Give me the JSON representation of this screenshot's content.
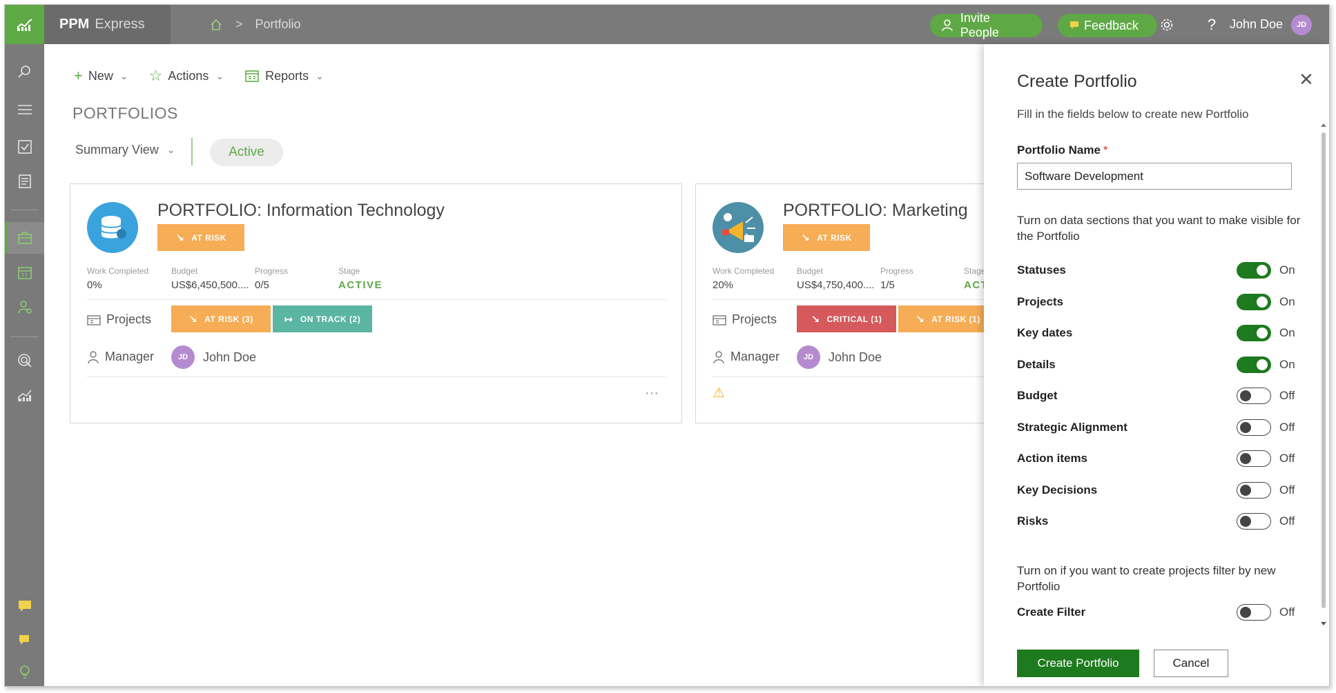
{
  "header": {
    "brand_main": "PPM",
    "brand_sub": "Express",
    "breadcrumb": "Portfolio",
    "invite_label": "Invite People",
    "feedback_label": "Feedback",
    "help_label": "?",
    "user_name": "John Doe",
    "user_initials": "JD"
  },
  "toolbar": {
    "new_label": "New",
    "actions_label": "Actions",
    "reports_label": "Reports"
  },
  "page": {
    "title": "PORTFOLIOS",
    "view_label": "Summary View",
    "filter_active": "Active"
  },
  "stat_labels": {
    "work_completed": "Work Completed",
    "budget": "Budget",
    "progress": "Progress",
    "stage": "Stage",
    "projects": "Projects",
    "manager": "Manager"
  },
  "cards": [
    {
      "title": "PORTFOLIO: Information Technology",
      "status": "AT RISK",
      "work_completed": "0%",
      "budget": "US$6,450,500....",
      "progress": "0/5",
      "stage": "ACTIVE",
      "project_badges": [
        "AT RISK (3)",
        "ON TRACK (2)"
      ],
      "manager_initials": "JD",
      "manager_name": "John Doe",
      "more": "···"
    },
    {
      "title": "PORTFOLIO: Marketing",
      "status": "AT RISK",
      "work_completed": "20%",
      "budget": "US$4,750,400....",
      "progress": "1/5",
      "stage_label": "Stage",
      "stage": "ACT",
      "project_badges": [
        "CRITICAL (1)",
        "AT RISK (1)"
      ],
      "manager_initials": "JD",
      "manager_name": "John Doe",
      "warning": "⚠"
    }
  ],
  "panel": {
    "title": "Create Portfolio",
    "subtitle": "Fill in the fields below to create new Portfolio",
    "name_label": "Portfolio Name",
    "required_mark": "*",
    "name_value": "Software Development",
    "sections_desc": "Turn on data sections that you want to make visible for the Portfolio",
    "toggles": [
      {
        "label": "Statuses",
        "state": "On"
      },
      {
        "label": "Projects",
        "state": "On"
      },
      {
        "label": "Key dates",
        "state": "On"
      },
      {
        "label": "Details",
        "state": "On"
      },
      {
        "label": "Budget",
        "state": "Off"
      },
      {
        "label": "Strategic Alignment",
        "state": "Off"
      },
      {
        "label": "Action items",
        "state": "Off"
      },
      {
        "label": "Key Decisions",
        "state": "Off"
      },
      {
        "label": "Risks",
        "state": "Off"
      }
    ],
    "filter_desc": "Turn on if you want to create projects filter by new Portfolio",
    "filter_toggle": {
      "label": "Create Filter",
      "state": "Off"
    },
    "create_label": "Create Portfolio",
    "cancel_label": "Cancel"
  },
  "colors": {
    "brand_green": "#5fa846",
    "dark_green": "#1e7a1e",
    "at_risk": "#f6ad55",
    "on_track": "#5ab5a3",
    "critical": "#d6595b",
    "chrome_gray": "#7a7a7a"
  }
}
